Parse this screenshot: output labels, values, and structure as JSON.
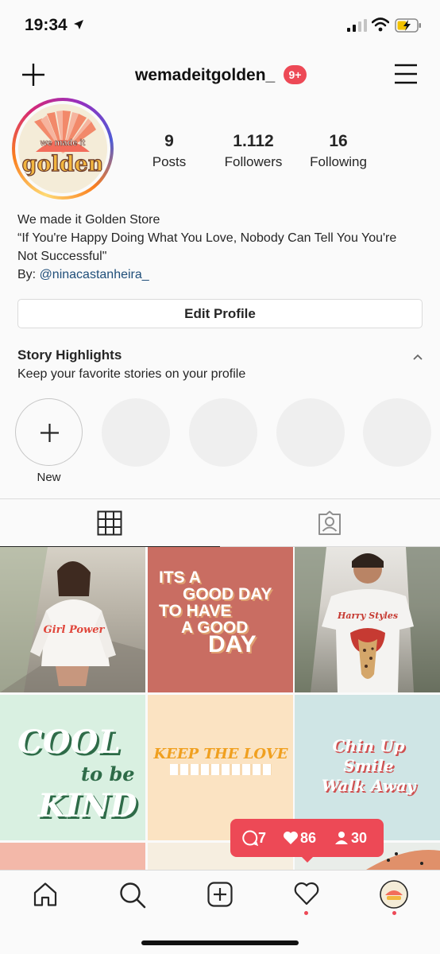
{
  "status_bar": {
    "time": "19:34"
  },
  "header": {
    "username": "wemadeitgolden_",
    "notification_badge": "9+"
  },
  "profile": {
    "avatar_text_top": "we made it",
    "avatar_text_bottom": "golden",
    "stats": [
      {
        "value": "9",
        "label": "Posts"
      },
      {
        "value": "1.112",
        "label": "Followers"
      },
      {
        "value": "16",
        "label": "Following"
      }
    ],
    "bio_name": "We made it Golden Store",
    "bio_quote_line1": "“If You're Happy Doing What You Love, Nobody Can Tell You You're",
    "bio_quote_line2": "Not Successful\"",
    "bio_by_prefix": "By: ",
    "bio_by_link": "@ninacastanheira_",
    "edit_profile_label": "Edit Profile"
  },
  "highlights": {
    "title": "Story Highlights",
    "subtitle": "Keep your favorite stories on your profile",
    "new_label": "New"
  },
  "posts": {
    "tile1_shirt": "Girl Power",
    "tile2_line1": "ITS A",
    "tile2_line2": "GOOD DAY",
    "tile2_line3": "TO HAVE",
    "tile2_line4": "A GOOD",
    "tile2_line5": "DAY",
    "tile3_shirt": "Harry Styles",
    "tile4_line1": "COOL",
    "tile4_line2": "to be",
    "tile4_line3": "KIND",
    "tile5_line1": "KEEP THE LOVE",
    "tile6_line1": "Chin Up",
    "tile6_line2": "Smile",
    "tile6_line3": "Walk Away"
  },
  "activity_popup": {
    "comments": "7",
    "likes": "86",
    "follows": "30"
  },
  "colors": {
    "accent_red": "#ed4956",
    "link_blue": "#1f4e79"
  }
}
